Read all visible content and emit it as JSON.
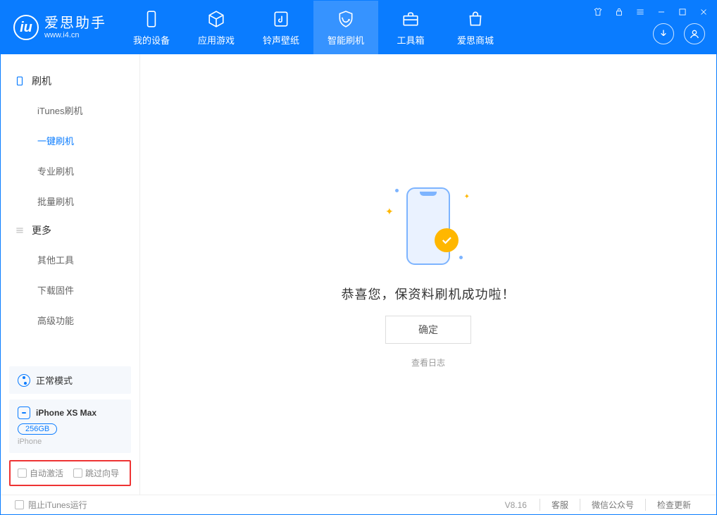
{
  "app": {
    "title": "爱思助手",
    "subtitle": "www.i4.cn"
  },
  "nav": {
    "items": [
      {
        "label": "我的设备"
      },
      {
        "label": "应用游戏"
      },
      {
        "label": "铃声壁纸"
      },
      {
        "label": "智能刷机"
      },
      {
        "label": "工具箱"
      },
      {
        "label": "爱思商城"
      }
    ]
  },
  "sidebar": {
    "section1": {
      "title": "刷机",
      "items": [
        "iTunes刷机",
        "一键刷机",
        "专业刷机",
        "批量刷机"
      ]
    },
    "section2": {
      "title": "更多",
      "items": [
        "其他工具",
        "下载固件",
        "高级功能"
      ]
    },
    "mode_label": "正常模式",
    "device": {
      "name": "iPhone XS Max",
      "storage": "256GB",
      "type": "iPhone"
    },
    "opts": {
      "auto_activate": "自动激活",
      "skip_guide": "跳过向导"
    }
  },
  "main": {
    "success_text": "恭喜您，保资料刷机成功啦！",
    "ok_label": "确定",
    "log_link": "查看日志"
  },
  "footer": {
    "block_itunes": "阻止iTunes运行",
    "version": "V8.16",
    "links": [
      "客服",
      "微信公众号",
      "检查更新"
    ]
  }
}
